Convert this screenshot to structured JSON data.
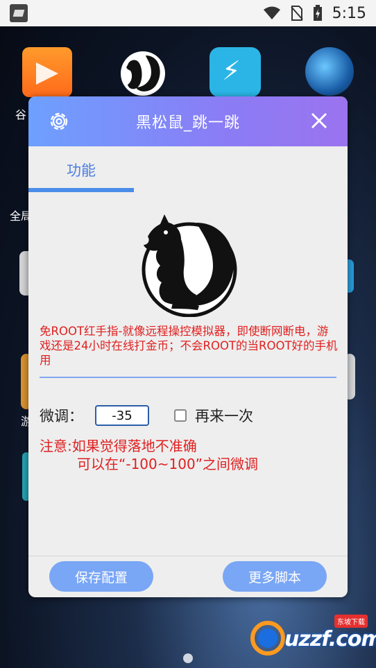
{
  "status_bar": {
    "time": "5:15",
    "icons": [
      "app-notification-icon",
      "wifi-icon",
      "no-sim-icon",
      "battery-charging-icon"
    ]
  },
  "desktop": {
    "icons": [
      "app-store-icon",
      "squirrel-app-icon",
      "bolt-app-icon",
      "globe-app-icon"
    ],
    "label_1": "谷",
    "label_2": "全局",
    "label_3": "游"
  },
  "dialog": {
    "title": "黑松鼠_跳一跳",
    "tab_label": "功能",
    "description": "免ROOT红手指-就像远程操控模拟器，即使断网断电，游戏还是24小时在线打金币；不会ROOT的当ROOT好的手机用",
    "adjust_label": "微调：",
    "adjust_value": "-35",
    "retry_label": "再来一次",
    "retry_checked": false,
    "note_line1": "注意:如果觉得落地不准确",
    "note_line2": "可以在“-100~100”之间微调",
    "save_button": "保存配置",
    "more_button": "更多脚本"
  },
  "watermark": {
    "text": "uzzf.com",
    "badge": "东坡下载"
  },
  "colors": {
    "header_gradient_start": "#6da0ff",
    "header_gradient_end": "#9b73ef",
    "accent_blue": "#4a8de8",
    "warning_red": "#e02020",
    "button_blue": "#79a6f5"
  }
}
